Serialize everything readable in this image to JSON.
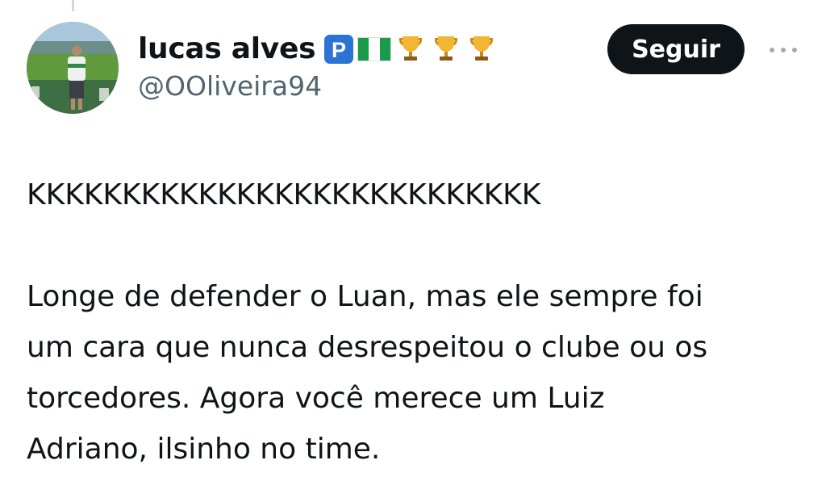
{
  "tweet": {
    "author": {
      "display_name": "lucas alves",
      "handle": "@OOliveira94",
      "badges": [
        {
          "icon": "parking-p-icon",
          "color": "#2b73d4"
        },
        {
          "icon": "nigeria-flag-icon",
          "color": "#1a9b4a"
        },
        {
          "icon": "trophy-icon",
          "color": "#e0a42a"
        },
        {
          "icon": "trophy-icon",
          "color": "#e0a42a"
        },
        {
          "icon": "trophy-icon",
          "color": "#e0a42a"
        }
      ]
    },
    "follow_label": "Seguir",
    "text": "KKKKKKKKKKKKKKKKKKKKKKKKKKK\n\nLonge de defender o Luan, mas ele sempre foi\num cara que nunca desrespeitou o clube ou os\ntorcedores. Agora você merece um Luiz\nAdriano, ilsinho no time."
  },
  "colors": {
    "text": "#0f1419",
    "secondary_text": "#536471",
    "button_bg": "#0f1419",
    "button_text": "#ffffff"
  }
}
